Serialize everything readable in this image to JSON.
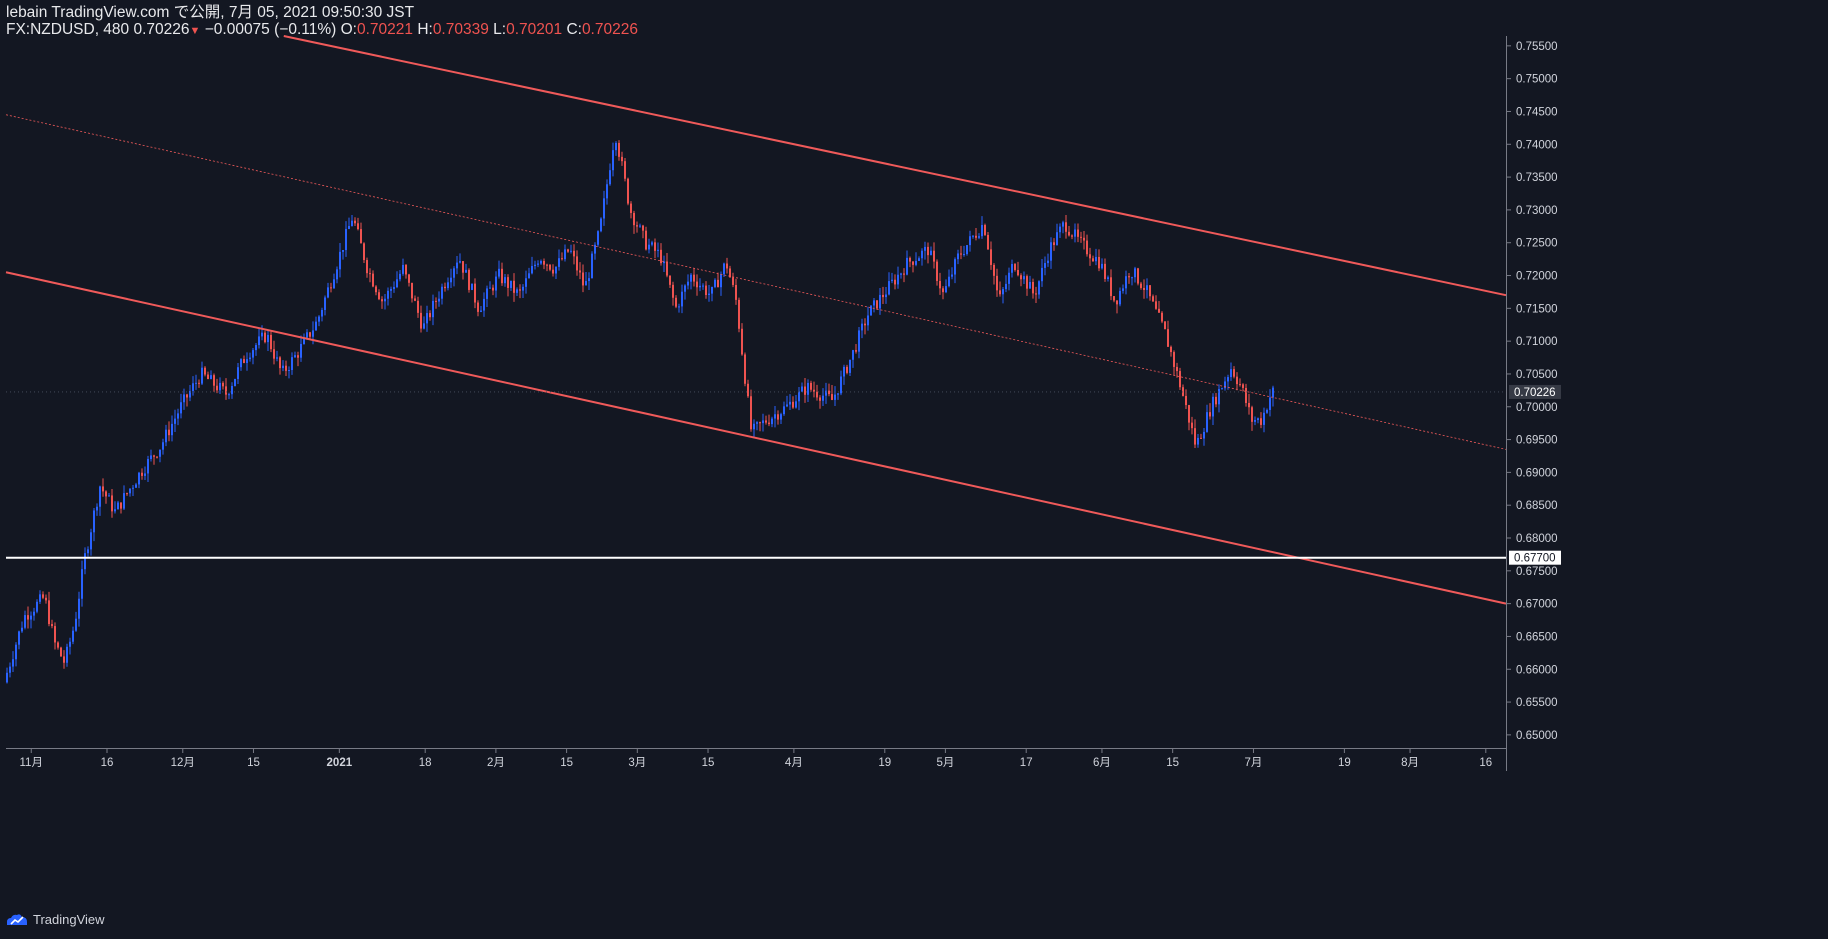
{
  "header": {
    "publisher": "lebain TradingView.com で公開, 7月 05, 2021 09:50:30 JST",
    "symbol": "FX:NZDUSD, 480",
    "last": "0.70226",
    "change": "−0.00075 (−0.11%)",
    "o_label": "O:",
    "o_value": "0.70221",
    "h_label": "H:",
    "h_value": "0.70339",
    "l_label": "L:",
    "l_value": "0.70201",
    "c_label": "C:",
    "c_value": "0.70226"
  },
  "footer": {
    "brand": "TradingView"
  },
  "colors": {
    "up": "#2962ff",
    "down": "#ef5350",
    "channel": "#f05a5a",
    "background": "#131722",
    "hline": "#ffffff"
  },
  "chart_data": {
    "type": "candlestick",
    "symbol": "FX:NZDUSD",
    "timeframe": "480",
    "ylim": [
      0.648,
      0.7565
    ],
    "y_ticks": [
      "0.75500",
      "0.75000",
      "0.74500",
      "0.74000",
      "0.73500",
      "0.73000",
      "0.72500",
      "0.72000",
      "0.71500",
      "0.71000",
      "0.70500",
      "0.70000",
      "0.69500",
      "0.69000",
      "0.68500",
      "0.68000",
      "0.67500",
      "0.67000",
      "0.66500",
      "0.66000",
      "0.65500",
      "0.65000"
    ],
    "x_ticks": [
      "11月",
      "16",
      "12月",
      "15",
      "2021",
      "18",
      "2月",
      "15",
      "3月",
      "15",
      "4月",
      "19",
      "5月",
      "17",
      "6月",
      "15",
      "7月",
      "19",
      "8月",
      "16"
    ],
    "x_tick_dates": [
      "2020-11-01",
      "2020-11-16",
      "2020-12-01",
      "2020-12-15",
      "2021-01-01",
      "2021-01-18",
      "2021-02-01",
      "2021-02-15",
      "2021-03-01",
      "2021-03-15",
      "2021-04-01",
      "2021-04-19",
      "2021-05-01",
      "2021-05-17",
      "2021-06-01",
      "2021-06-15",
      "2021-07-01",
      "2021-07-19",
      "2021-08-01",
      "2021-08-16"
    ],
    "price_path": [
      [
        "2020-10-27",
        0.658
      ],
      [
        "2020-10-31",
        0.668
      ],
      [
        "2020-11-04",
        0.671
      ],
      [
        "2020-11-06",
        0.664
      ],
      [
        "2020-11-08",
        0.661
      ],
      [
        "2020-11-10",
        0.667
      ],
      [
        "2020-11-12",
        0.677
      ],
      [
        "2020-11-15",
        0.688
      ],
      [
        "2020-11-18",
        0.684
      ],
      [
        "2020-11-23",
        0.69
      ],
      [
        "2020-11-27",
        0.694
      ],
      [
        "2020-12-01",
        0.7
      ],
      [
        "2020-12-05",
        0.705
      ],
      [
        "2020-12-10",
        0.702
      ],
      [
        "2020-12-14",
        0.708
      ],
      [
        "2020-12-18",
        0.711
      ],
      [
        "2020-12-21",
        0.705
      ],
      [
        "2020-12-24",
        0.708
      ],
      [
        "2020-12-28",
        0.713
      ],
      [
        "2021-01-01",
        0.722
      ],
      [
        "2021-01-04",
        0.729
      ],
      [
        "2021-01-07",
        0.721
      ],
      [
        "2021-01-10",
        0.716
      ],
      [
        "2021-01-14",
        0.721
      ],
      [
        "2021-01-18",
        0.712
      ],
      [
        "2021-01-21",
        0.717
      ],
      [
        "2021-01-25",
        0.723
      ],
      [
        "2021-01-29",
        0.715
      ],
      [
        "2021-02-02",
        0.72
      ],
      [
        "2021-02-06",
        0.717
      ],
      [
        "2021-02-10",
        0.723
      ],
      [
        "2021-02-13",
        0.721
      ],
      [
        "2021-02-16",
        0.724
      ],
      [
        "2021-02-19",
        0.718
      ],
      [
        "2021-02-22",
        0.727
      ],
      [
        "2021-02-25",
        0.742
      ],
      [
        "2021-02-28",
        0.73
      ],
      [
        "2021-03-03",
        0.725
      ],
      [
        "2021-03-06",
        0.723
      ],
      [
        "2021-03-09",
        0.715
      ],
      [
        "2021-03-12",
        0.72
      ],
      [
        "2021-03-16",
        0.717
      ],
      [
        "2021-03-19",
        0.722
      ],
      [
        "2021-03-21",
        0.716
      ],
      [
        "2021-03-24",
        0.696
      ],
      [
        "2021-03-27",
        0.698
      ],
      [
        "2021-03-31",
        0.7
      ],
      [
        "2021-04-04",
        0.703
      ],
      [
        "2021-04-09",
        0.701
      ],
      [
        "2021-04-13",
        0.708
      ],
      [
        "2021-04-16",
        0.714
      ],
      [
        "2021-04-20",
        0.718
      ],
      [
        "2021-04-24",
        0.722
      ],
      [
        "2021-04-28",
        0.724
      ],
      [
        "2021-05-01",
        0.717
      ],
      [
        "2021-05-04",
        0.723
      ],
      [
        "2021-05-09",
        0.728
      ],
      [
        "2021-05-12",
        0.716
      ],
      [
        "2021-05-15",
        0.722
      ],
      [
        "2021-05-19",
        0.717
      ],
      [
        "2021-05-22",
        0.724
      ],
      [
        "2021-05-25",
        0.728
      ],
      [
        "2021-05-28",
        0.725
      ],
      [
        "2021-06-01",
        0.722
      ],
      [
        "2021-06-04",
        0.716
      ],
      [
        "2021-06-07",
        0.721
      ],
      [
        "2021-06-10",
        0.718
      ],
      [
        "2021-06-14",
        0.711
      ],
      [
        "2021-06-17",
        0.703
      ],
      [
        "2021-06-20",
        0.694
      ],
      [
        "2021-06-23",
        0.7
      ],
      [
        "2021-06-27",
        0.706
      ],
      [
        "2021-06-29",
        0.703
      ],
      [
        "2021-07-01",
        0.698
      ],
      [
        "2021-07-03",
        0.698
      ],
      [
        "2021-07-05",
        0.7023
      ]
    ],
    "channel_upper": [
      [
        "2020-12-21",
        0.7565
      ],
      [
        "2021-08-20",
        0.717
      ]
    ],
    "channel_middle": [
      [
        "2020-10-27",
        0.7445
      ],
      [
        "2021-08-20",
        0.6935
      ]
    ],
    "channel_lower": [
      [
        "2020-10-27",
        0.7205
      ],
      [
        "2021-08-20",
        0.67
      ]
    ],
    "horizontal_line": {
      "value": "0.67700"
    },
    "last_price_label": "0.70226",
    "grid": false,
    "legend": "none"
  }
}
